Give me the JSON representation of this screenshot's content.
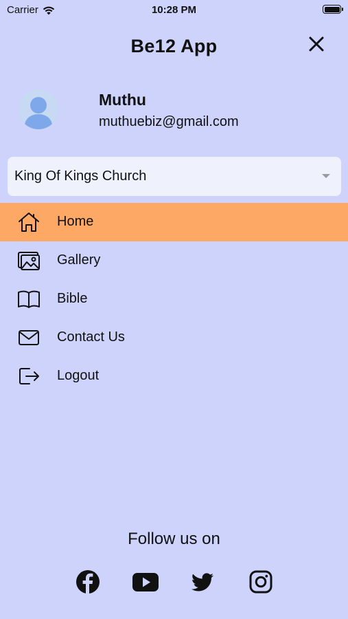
{
  "status_bar": {
    "carrier": "Carrier",
    "time": "10:28 PM"
  },
  "header": {
    "title": "Be12 App",
    "close_icon": "close-icon"
  },
  "profile": {
    "name": "Muthu",
    "email": "muthuebiz@gmail.com",
    "avatar_icon": "avatar-placeholder-icon"
  },
  "church_select": {
    "value": "King Of Kings Church"
  },
  "menu": {
    "items": [
      {
        "label": "Home",
        "icon": "home-icon",
        "active": true
      },
      {
        "label": "Gallery",
        "icon": "gallery-icon",
        "active": false
      },
      {
        "label": "Bible",
        "icon": "book-icon",
        "active": false
      },
      {
        "label": "Contact Us",
        "icon": "mail-icon",
        "active": false
      },
      {
        "label": "Logout",
        "icon": "logout-icon",
        "active": false
      }
    ]
  },
  "follow": {
    "title": "Follow us on",
    "socials": [
      "facebook-icon",
      "youtube-icon",
      "twitter-icon",
      "instagram-icon"
    ]
  },
  "colors": {
    "background": "#cdd3fa",
    "active_item": "#fea866",
    "select_bg": "#eff1fd"
  }
}
